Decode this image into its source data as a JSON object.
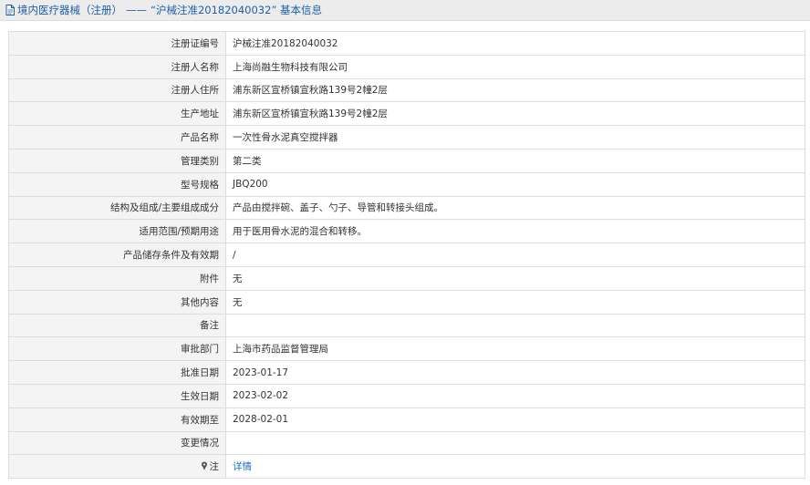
{
  "header": {
    "category": "境内医疗器械（注册）",
    "separator": "——",
    "title": "“沪械注准20182040032” 基本信息"
  },
  "rows": [
    {
      "label": "注册证编号",
      "value": "沪械注准20182040032"
    },
    {
      "label": "注册人名称",
      "value": "上海尚融生物科技有限公司"
    },
    {
      "label": "注册人住所",
      "value": "浦东新区宣桥镇宣秋路139号2幢2层"
    },
    {
      "label": "生产地址",
      "value": "浦东新区宣桥镇宣秋路139号2幢2层"
    },
    {
      "label": "产品名称",
      "value": "一次性骨水泥真空搅拌器"
    },
    {
      "label": "管理类别",
      "value": "第二类"
    },
    {
      "label": "型号规格",
      "value": "JBQ200"
    },
    {
      "label": "结构及组成/主要组成成分",
      "value": "产品由搅拌碗、盖子、勺子、导管和转接头组成。"
    },
    {
      "label": "适用范围/预期用途",
      "value": "用于医用骨水泥的混合和转移。"
    },
    {
      "label": "产品储存条件及有效期",
      "value": "/"
    },
    {
      "label": "附件",
      "value": "无"
    },
    {
      "label": "其他内容",
      "value": "无"
    },
    {
      "label": "备注",
      "value": ""
    },
    {
      "label": "审批部门",
      "value": "上海市药品监督管理局"
    },
    {
      "label": "批准日期",
      "value": "2023-01-17"
    },
    {
      "label": "生效日期",
      "value": "2023-02-02"
    },
    {
      "label": "有效期至",
      "value": "2028-02-01"
    },
    {
      "label": "变更情况",
      "value": ""
    }
  ],
  "note_row": {
    "label": "注",
    "link_text": "详情"
  },
  "colors": {
    "title_text": "#1f5fa8",
    "link": "#1f6fc5",
    "label_bg": "#f4f4f4",
    "border": "#dddddd"
  }
}
